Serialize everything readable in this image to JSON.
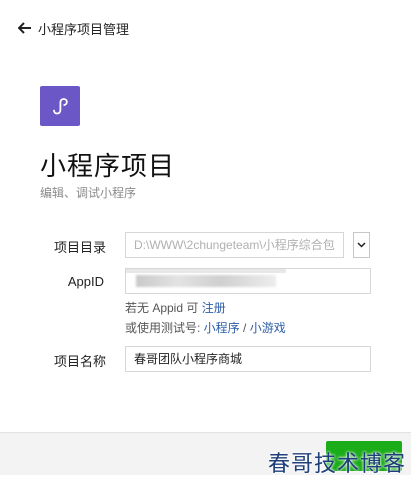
{
  "header": {
    "back_label": "小程序项目管理"
  },
  "page": {
    "title": "小程序项目",
    "subtitle": "编辑、调试小程序"
  },
  "form": {
    "dir_label": "项目目录",
    "dir_value": "D:\\WWW\\2chungeteam\\小程序综合包",
    "appid_label": "AppID",
    "appid_value": "",
    "hint_no_appid_prefix": "若无 Appid 可 ",
    "hint_register_link": "注册",
    "hint_test_prefix": "或使用测试号: ",
    "hint_link_miniprogram": "小程序",
    "hint_separator": " / ",
    "hint_link_minigame": "小游戏",
    "name_label": "项目名称",
    "name_value": "春哥团队小程序商城"
  },
  "watermark": {
    "text": "春哥技术博客"
  },
  "colors": {
    "logo_bg": "#6b58c6",
    "link": "#2c5ea8",
    "confirm_green": "#1aad19"
  }
}
